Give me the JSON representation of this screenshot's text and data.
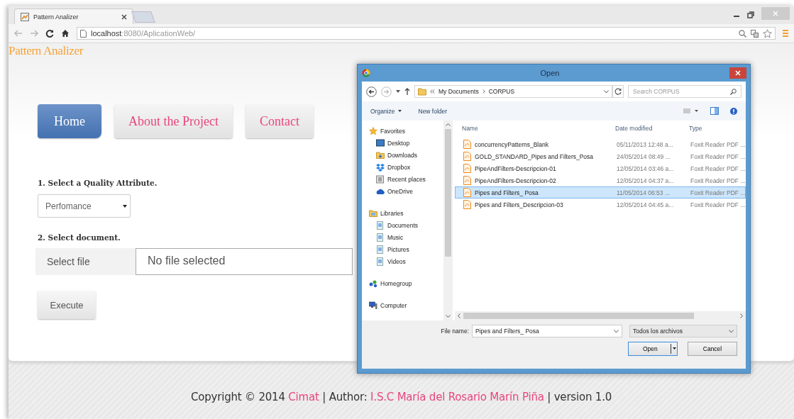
{
  "browser": {
    "tab_title": "Pattern Analizer",
    "url_host": "localhost",
    "url_rest": ":8080/AplicationWeb/"
  },
  "page": {
    "brand": "Pattern Analizer",
    "nav": [
      {
        "label": "Home",
        "selected": true
      },
      {
        "label": "About the Project",
        "selected": false
      },
      {
        "label": "Contact",
        "selected": false
      }
    ],
    "quality_label": "1. Select a Quality Attribute.",
    "quality_value": "Perfomance",
    "document_label": "2. Select document.",
    "file_button": "Select file",
    "file_status": "No file selected",
    "execute": "Execute"
  },
  "footer": [
    {
      "kind": "text",
      "text": "Copyright © 2014 "
    },
    {
      "kind": "link",
      "text": "Cimat"
    },
    {
      "kind": "text",
      "text": " | Author: "
    },
    {
      "kind": "link",
      "text": "I.S.C María del Rosario Marín Piña"
    },
    {
      "kind": "text",
      "text": " | version 1.0"
    }
  ],
  "dialog": {
    "title": "Open",
    "breadcrumb": [
      "My Documents",
      "CORPUS"
    ],
    "search_placeholder": "Search CORPUS",
    "toolbar": [
      "Organize",
      "New folder"
    ],
    "sidebar": [
      {
        "label": "Favorites",
        "children": [
          {
            "label": "Desktop"
          },
          {
            "label": "Downloads"
          },
          {
            "label": "Dropbox"
          },
          {
            "label": "Recent places"
          },
          {
            "label": "OneDrive"
          }
        ]
      },
      {
        "label": "Libraries",
        "children": [
          {
            "label": "Documents"
          },
          {
            "label": "Music"
          },
          {
            "label": "Pictures"
          },
          {
            "label": "Videos"
          }
        ]
      },
      {
        "label": "Homegroup"
      },
      {
        "label": "Computer"
      }
    ],
    "columns": [
      "Name",
      "Date modified",
      "Type"
    ],
    "files": [
      {
        "name": "concurrencyPatterns_Blank",
        "date": "05/11/2013 12:48 a...",
        "type": "Foxit Reader PDF ...",
        "selected": false
      },
      {
        "name": "GOLD_STANDARD_Pipes and Filters_Posa",
        "date": "24/05/2014 08:49 ...",
        "type": "Foxit Reader PDF ...",
        "selected": false
      },
      {
        "name": "PipeAndFilters-Descripcion-01",
        "date": "12/05/2014 03:46 a...",
        "type": "Foxit Reader PDF ...",
        "selected": false
      },
      {
        "name": "PipeAndFilters-Descripcion-02",
        "date": "12/05/2014 04:37 a...",
        "type": "Foxit Reader PDF ...",
        "selected": false
      },
      {
        "name": "Pipes and Filters_ Posa",
        "date": "11/05/2014 06:53 ...",
        "type": "Foxit Reader PDF ...",
        "selected": true
      },
      {
        "name": "Pipes and Filters_Descripcion-03",
        "date": "12/05/2014 04:45 a...",
        "type": "Foxit Reader PDF ...",
        "selected": false
      }
    ],
    "file_name_label": "File name:",
    "file_name": "Pipes and Filters_ Posa",
    "file_type": "Todos los archivos",
    "buttons": [
      "Open",
      "Cancel"
    ]
  }
}
